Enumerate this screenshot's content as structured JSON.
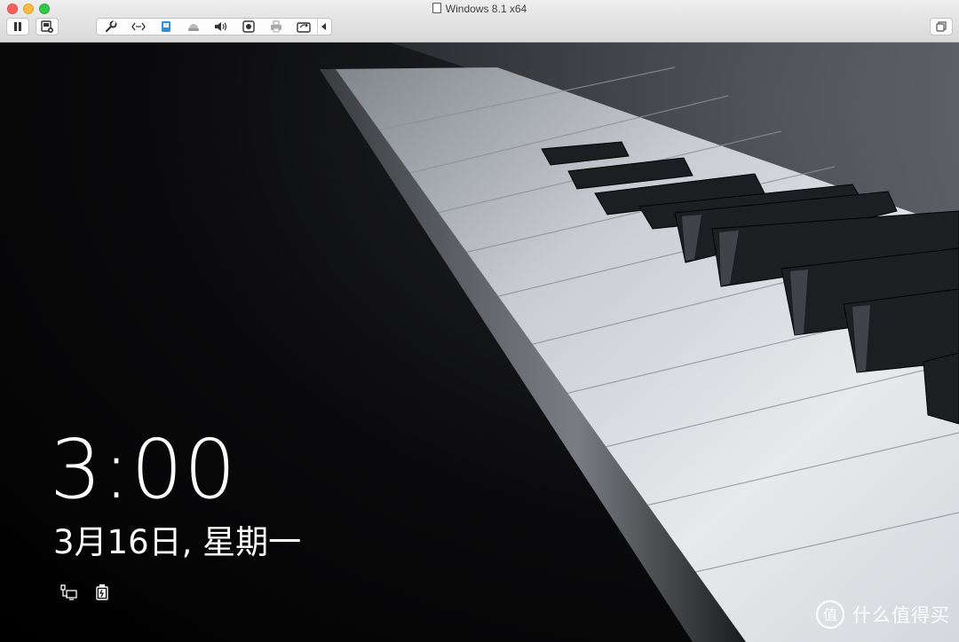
{
  "window": {
    "title": "Windows 8.1 x64",
    "traffic_lights": [
      "close",
      "minimize",
      "zoom"
    ]
  },
  "toolbar": {
    "left_buttons": [
      "pause-icon",
      "snapshot-icon"
    ],
    "device_group": [
      "wrench-icon",
      "network-icon",
      "usb-drive-icon",
      "cdrom-icon",
      "sound-icon",
      "camera-icon",
      "printer-icon",
      "shared-folder-icon"
    ],
    "collapse_arrow": "chevron-left-icon",
    "right_button": "fullscreen-icon"
  },
  "lock_screen": {
    "time": "3:00",
    "date": "3月16日, 星期一",
    "status_icons": [
      "network-status-icon",
      "battery-status-icon"
    ],
    "background": "piano-keys-photo"
  },
  "watermark": {
    "text": "什么值得买",
    "logo": "zhi-logo-icon"
  }
}
